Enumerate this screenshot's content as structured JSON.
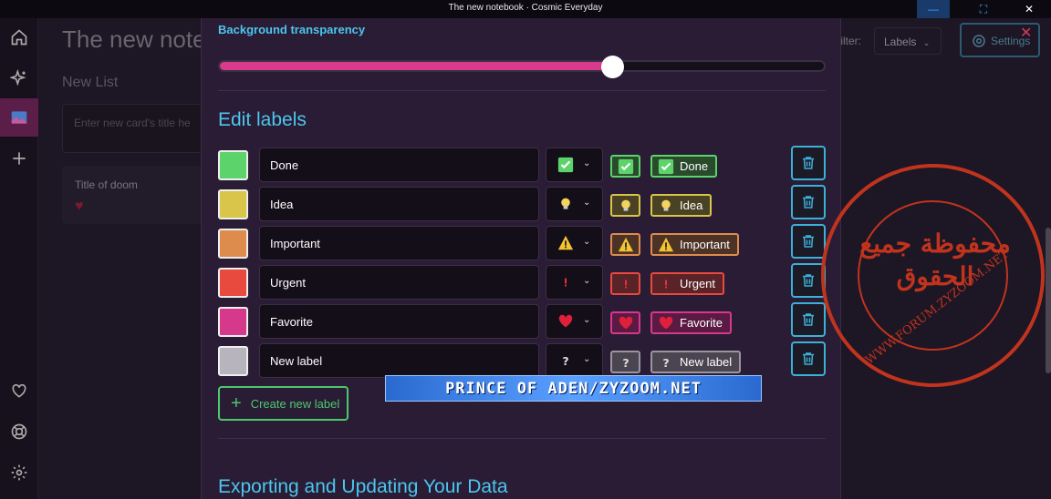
{
  "window": {
    "title": "The new notebook · Cosmic Everyday",
    "minimize": "—",
    "maximize": "⛶",
    "close": "✕"
  },
  "background": {
    "page_title": "The new note",
    "new_list": "New List",
    "card_input_placeholder": "Enter new card's title he",
    "card_title": "Title of doom",
    "filter_label": "filter:",
    "labels_select": "Labels",
    "settings_button": "Settings",
    "modal_close": "✕"
  },
  "modal": {
    "transparency_title": "Background transparency",
    "transparency_value": 0.65,
    "edit_labels_title": "Edit labels",
    "labels": [
      {
        "name": "Done",
        "color": "#5dd36b",
        "icon": "check-icon",
        "pill_bg": "#2a4a2c",
        "pill_border": "#5dd36b"
      },
      {
        "name": "Idea",
        "color": "#d8c54a",
        "icon": "lightbulb-icon",
        "pill_bg": "#4a4224",
        "pill_border": "#d8c54a"
      },
      {
        "name": "Important",
        "color": "#dd8c4e",
        "icon": "warning-icon",
        "pill_bg": "#4d3226",
        "pill_border": "#dd8c4e"
      },
      {
        "name": "Urgent",
        "color": "#e84a3e",
        "icon": "exclamation-icon",
        "pill_bg": "#5a2328",
        "pill_border": "#e84a3e"
      },
      {
        "name": "Favorite",
        "color": "#d6398c",
        "icon": "heart-icon",
        "pill_bg": "#5a1a44",
        "pill_border": "#d6398c"
      },
      {
        "name": "New label",
        "color": "#b8b4be",
        "icon": "question-icon",
        "pill_bg": "#4a4550",
        "pill_border": "#9a96a0"
      }
    ],
    "create_label_button": "Create new label",
    "export_title": "Exporting and Updating Your Data"
  },
  "watermarks": {
    "banner": "PRINCE OF ADEN/ZYZOOM.NET",
    "seal_text": "محفوظة جميع الحقوق",
    "seal_url": "WWW.FORUM.ZYZOOM.NET"
  },
  "colors": {
    "accent": "#4cc6ee",
    "slider": "#d93a8c",
    "create_button": "#4cc86c",
    "delete_button": "#3db0d6"
  }
}
